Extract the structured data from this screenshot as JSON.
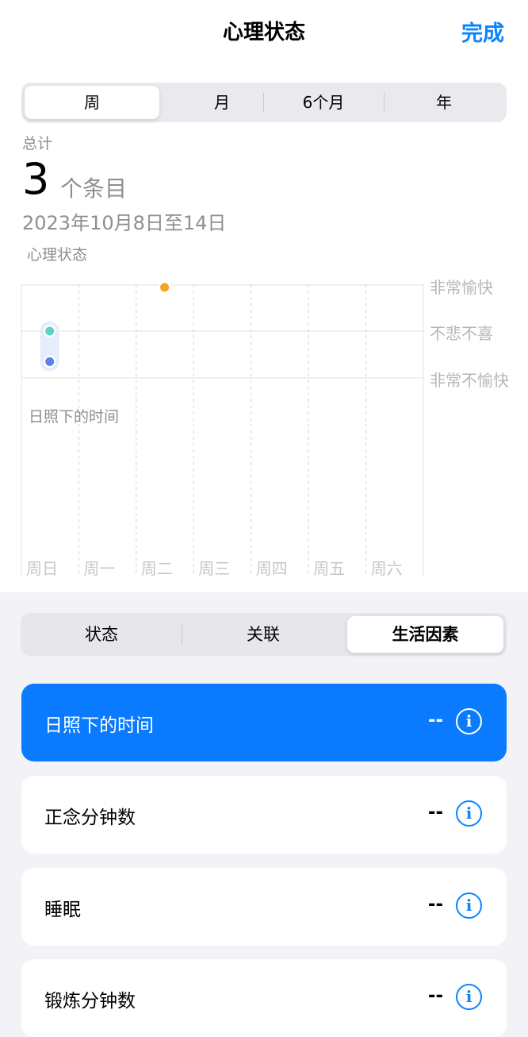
{
  "nav": {
    "title": "心理状态",
    "done": "完成"
  },
  "range_tabs": [
    {
      "label": "周",
      "selected": true
    },
    {
      "label": "月",
      "selected": false
    },
    {
      "label": "6个月",
      "selected": false
    },
    {
      "label": "年",
      "selected": false
    }
  ],
  "summary": {
    "total_label": "总计",
    "count": "3",
    "count_unit": "个条目",
    "date_range": "2023年10月8日至14日"
  },
  "chart_data": {
    "type": "scatter",
    "title": "心理状态",
    "x_categories": [
      "周日",
      "周一",
      "周二",
      "周三",
      "周四",
      "周五",
      "周六"
    ],
    "y_levels": [
      "非常愉快",
      "不悲不喜",
      "非常不愉快"
    ],
    "points": [
      {
        "day": "周日",
        "value": 0.0,
        "color": "#5ed3c7"
      },
      {
        "day": "周日",
        "value": -0.65,
        "color": "#5a84e8"
      },
      {
        "day": "周二",
        "value": 0.95,
        "color": "#f5a623"
      }
    ],
    "ylim": [
      -1,
      1
    ],
    "secondary_label": "日照下的时间",
    "grid": true
  },
  "factor_tabs": [
    {
      "label": "状态",
      "selected": false
    },
    {
      "label": "关联",
      "selected": false
    },
    {
      "label": "生活因素",
      "selected": true
    }
  ],
  "factors": [
    {
      "label": "日照下的时间",
      "value": "--",
      "active": true
    },
    {
      "label": "正念分钟数",
      "value": "--",
      "active": false
    },
    {
      "label": "睡眠",
      "value": "--",
      "active": false
    },
    {
      "label": "锻炼分钟数",
      "value": "--",
      "active": false
    }
  ],
  "colors": {
    "accent": "#0a84ff",
    "active_card": "#0a7bff"
  }
}
